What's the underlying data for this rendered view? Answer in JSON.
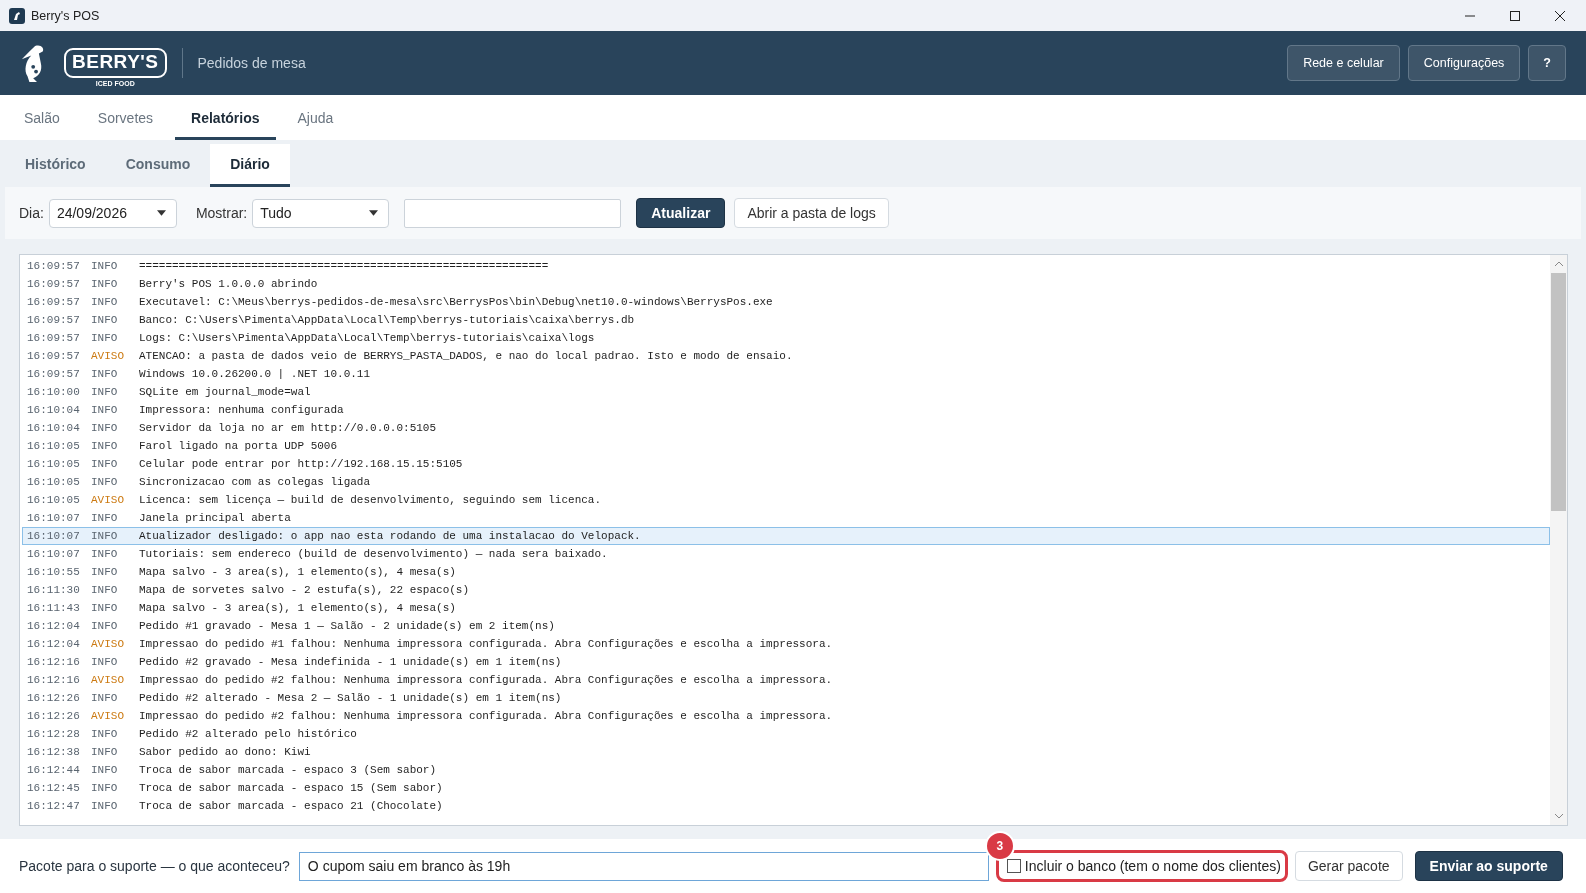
{
  "window": {
    "title": "Berry's POS"
  },
  "header": {
    "logo_text": "BERRY'S",
    "logo_subtext": "ICED FOOD",
    "subtitle": "Pedidos de mesa",
    "buttons": [
      "Rede e celular",
      "Configurações",
      "?"
    ]
  },
  "tabs": [
    {
      "label": "Salão",
      "selected": false
    },
    {
      "label": "Sorvetes",
      "selected": false
    },
    {
      "label": "Relatórios",
      "selected": true
    },
    {
      "label": "Ajuda",
      "selected": false
    }
  ],
  "subtabs": [
    {
      "label": "Histórico",
      "selected": false
    },
    {
      "label": "Consumo",
      "selected": false
    },
    {
      "label": "Diário",
      "selected": true
    }
  ],
  "toolbar": {
    "day_label": "Dia:",
    "day_value": "24/09/2026",
    "show_label": "Mostrar:",
    "show_value": "Tudo",
    "refresh_button": "Atualizar",
    "open_logs_button": "Abrir a pasta de logs"
  },
  "log": [
    {
      "time": "16:09:57",
      "level": "INFO",
      "kind": "info",
      "message": "==============================================================",
      "selected": false
    },
    {
      "time": "16:09:57",
      "level": "INFO",
      "kind": "info",
      "message": "Berry's POS 1.0.0.0 abrindo",
      "selected": false
    },
    {
      "time": "16:09:57",
      "level": "INFO",
      "kind": "info",
      "message": "Executavel: C:\\Meus\\berrys-pedidos-de-mesa\\src\\BerrysPos\\bin\\Debug\\net10.0-windows\\BerrysPos.exe",
      "selected": false
    },
    {
      "time": "16:09:57",
      "level": "INFO",
      "kind": "info",
      "message": "Banco: C:\\Users\\Pimenta\\AppData\\Local\\Temp\\berrys-tutoriais\\caixa\\berrys.db",
      "selected": false
    },
    {
      "time": "16:09:57",
      "level": "INFO",
      "kind": "info",
      "message": "Logs: C:\\Users\\Pimenta\\AppData\\Local\\Temp\\berrys-tutoriais\\caixa\\logs",
      "selected": false
    },
    {
      "time": "16:09:57",
      "level": "AVISO",
      "kind": "warning",
      "message": "ATENCAO: a pasta de dados veio de BERRYS_PASTA_DADOS, e nao do local padrao. Isto e modo de ensaio.",
      "selected": false
    },
    {
      "time": "16:09:57",
      "level": "INFO",
      "kind": "info",
      "message": "Windows 10.0.26200.0 | .NET 10.0.11",
      "selected": false
    },
    {
      "time": "16:10:00",
      "level": "INFO",
      "kind": "info",
      "message": "SQLite em journal_mode=wal",
      "selected": false
    },
    {
      "time": "16:10:04",
      "level": "INFO",
      "kind": "info",
      "message": "Impressora: nenhuma configurada",
      "selected": false
    },
    {
      "time": "16:10:04",
      "level": "INFO",
      "kind": "info",
      "message": "Servidor da loja no ar em http://0.0.0.0:5105",
      "selected": false
    },
    {
      "time": "16:10:05",
      "level": "INFO",
      "kind": "info",
      "message": "Farol ligado na porta UDP 5006",
      "selected": false
    },
    {
      "time": "16:10:05",
      "level": "INFO",
      "kind": "info",
      "message": "Celular pode entrar por http://192.168.15.15:5105",
      "selected": false
    },
    {
      "time": "16:10:05",
      "level": "INFO",
      "kind": "info",
      "message": "Sincronizacao com as colegas ligada",
      "selected": false
    },
    {
      "time": "16:10:05",
      "level": "AVISO",
      "kind": "warning",
      "message": "Licenca: sem licença — build de desenvolvimento, seguindo sem licenca.",
      "selected": false
    },
    {
      "time": "16:10:07",
      "level": "INFO",
      "kind": "info",
      "message": "Janela principal aberta",
      "selected": false
    },
    {
      "time": "16:10:07",
      "level": "INFO",
      "kind": "info",
      "message": "Atualizador desligado: o app nao esta rodando de uma instalacao do Velopack.",
      "selected": true
    },
    {
      "time": "16:10:07",
      "level": "INFO",
      "kind": "info",
      "message": "Tutoriais: sem endereco (build de desenvolvimento) — nada sera baixado.",
      "selected": false
    },
    {
      "time": "16:10:55",
      "level": "INFO",
      "kind": "info",
      "message": "Mapa salvo - 3 area(s), 1 elemento(s), 4 mesa(s)",
      "selected": false
    },
    {
      "time": "16:11:30",
      "level": "INFO",
      "kind": "info",
      "message": "Mapa de sorvetes salvo - 2 estufa(s), 22 espaco(s)",
      "selected": false
    },
    {
      "time": "16:11:43",
      "level": "INFO",
      "kind": "info",
      "message": "Mapa salvo - 3 area(s), 1 elemento(s), 4 mesa(s)",
      "selected": false
    },
    {
      "time": "16:12:04",
      "level": "INFO",
      "kind": "info",
      "message": "Pedido #1 gravado - Mesa 1 — Salão - 2 unidade(s) em 2 item(ns)",
      "selected": false
    },
    {
      "time": "16:12:04",
      "level": "AVISO",
      "kind": "warning",
      "message": "Impressao do pedido #1 falhou: Nenhuma impressora configurada. Abra Configurações e escolha a impressora.",
      "selected": false
    },
    {
      "time": "16:12:16",
      "level": "INFO",
      "kind": "info",
      "message": "Pedido #2 gravado - Mesa indefinida - 1 unidade(s) em 1 item(ns)",
      "selected": false
    },
    {
      "time": "16:12:16",
      "level": "AVISO",
      "kind": "warning",
      "message": "Impressao do pedido #2 falhou: Nenhuma impressora configurada. Abra Configurações e escolha a impressora.",
      "selected": false
    },
    {
      "time": "16:12:26",
      "level": "INFO",
      "kind": "info",
      "message": "Pedido #2 alterado - Mesa 2 — Salão - 1 unidade(s) em 1 item(ns)",
      "selected": false
    },
    {
      "time": "16:12:26",
      "level": "AVISO",
      "kind": "warning",
      "message": "Impressao do pedido #2 falhou: Nenhuma impressora configurada. Abra Configurações e escolha a impressora.",
      "selected": false
    },
    {
      "time": "16:12:28",
      "level": "INFO",
      "kind": "info",
      "message": "Pedido #2 alterado pelo histórico",
      "selected": false
    },
    {
      "time": "16:12:38",
      "level": "INFO",
      "kind": "info",
      "message": "Sabor pedido ao dono: Kiwi",
      "selected": false
    },
    {
      "time": "16:12:44",
      "level": "INFO",
      "kind": "info",
      "message": "Troca de sabor marcada - espaco 3 (Sem sabor)",
      "selected": false
    },
    {
      "time": "16:12:45",
      "level": "INFO",
      "kind": "info",
      "message": "Troca de sabor marcada - espaco 15 (Sem sabor)",
      "selected": false
    },
    {
      "time": "16:12:47",
      "level": "INFO",
      "kind": "info",
      "message": "Troca de sabor marcada - espaco 21 (Chocolate)",
      "selected": false
    }
  ],
  "support": {
    "label": "Pacote para o suporte — o que aconteceu?",
    "value": "O cupom saiu em branco às 19h",
    "include_db": {
      "label": "Incluir o banco (tem o nome dos clientes)",
      "checked": false
    },
    "annotation_badge": "3",
    "generate_button": "Gerar pacote",
    "send_button": "Enviar ao suporte"
  }
}
